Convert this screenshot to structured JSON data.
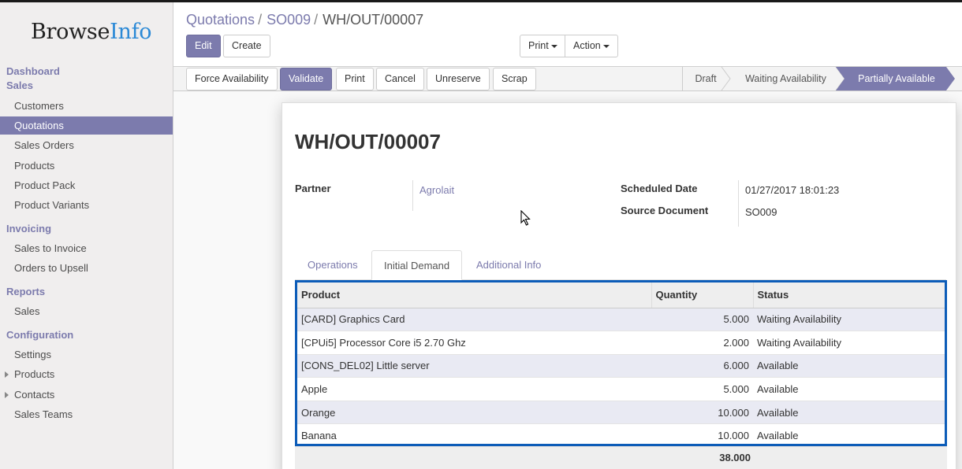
{
  "brand": {
    "part1": "Browse",
    "part2": "Info"
  },
  "sidebar": {
    "sections": [
      {
        "label": "Dashboard"
      },
      {
        "label": "Sales"
      },
      {
        "label": "Invoicing"
      },
      {
        "label": "Reports"
      },
      {
        "label": "Configuration"
      }
    ],
    "items": [
      {
        "label": "Customers"
      },
      {
        "label": "Quotations"
      },
      {
        "label": "Sales Orders"
      },
      {
        "label": "Products"
      },
      {
        "label": "Product Pack"
      },
      {
        "label": "Product Variants"
      },
      {
        "label": "Sales to Invoice"
      },
      {
        "label": "Orders to Upsell"
      },
      {
        "label": "Sales"
      },
      {
        "label": "Settings"
      },
      {
        "label": "Products"
      },
      {
        "label": "Contacts"
      },
      {
        "label": "Sales Teams"
      }
    ]
  },
  "breadcrumb": {
    "crumb1": "Quotations",
    "crumb2": "SO009",
    "current": "WH/OUT/00007",
    "sep": "/"
  },
  "control": {
    "edit": "Edit",
    "create": "Create",
    "print": "Print",
    "action": "Action"
  },
  "header": {
    "buttons": [
      "Force Availability",
      "Validate",
      "Print",
      "Cancel",
      "Unreserve",
      "Scrap"
    ],
    "stages": [
      "Draft",
      "Waiting Availability",
      "Partially Available"
    ]
  },
  "form": {
    "title": "WH/OUT/00007",
    "partner_label": "Partner",
    "partner_value": "Agrolait",
    "scheduled_label": "Scheduled Date",
    "scheduled_value": "01/27/2017 18:01:23",
    "source_label": "Source Document",
    "source_value": "SO009"
  },
  "tabs": [
    "Operations",
    "Initial Demand",
    "Additional Info"
  ],
  "table": {
    "headers": [
      "Product",
      "Quantity",
      "Status"
    ],
    "rows": [
      [
        "[CARD] Graphics Card",
        "5.000",
        "Waiting Availability"
      ],
      [
        "[CPUi5] Processor Core i5 2.70 Ghz",
        "2.000",
        "Waiting Availability"
      ],
      [
        "[CONS_DEL02] Little server",
        "6.000",
        "Available"
      ],
      [
        "Apple",
        "5.000",
        "Available"
      ],
      [
        "Orange",
        "10.000",
        "Available"
      ],
      [
        "Banana",
        "10.000",
        "Available"
      ]
    ],
    "total": "38.000"
  },
  "colors": {
    "accent": "#7c7bad",
    "highlight_border": "#0c5cb8"
  }
}
